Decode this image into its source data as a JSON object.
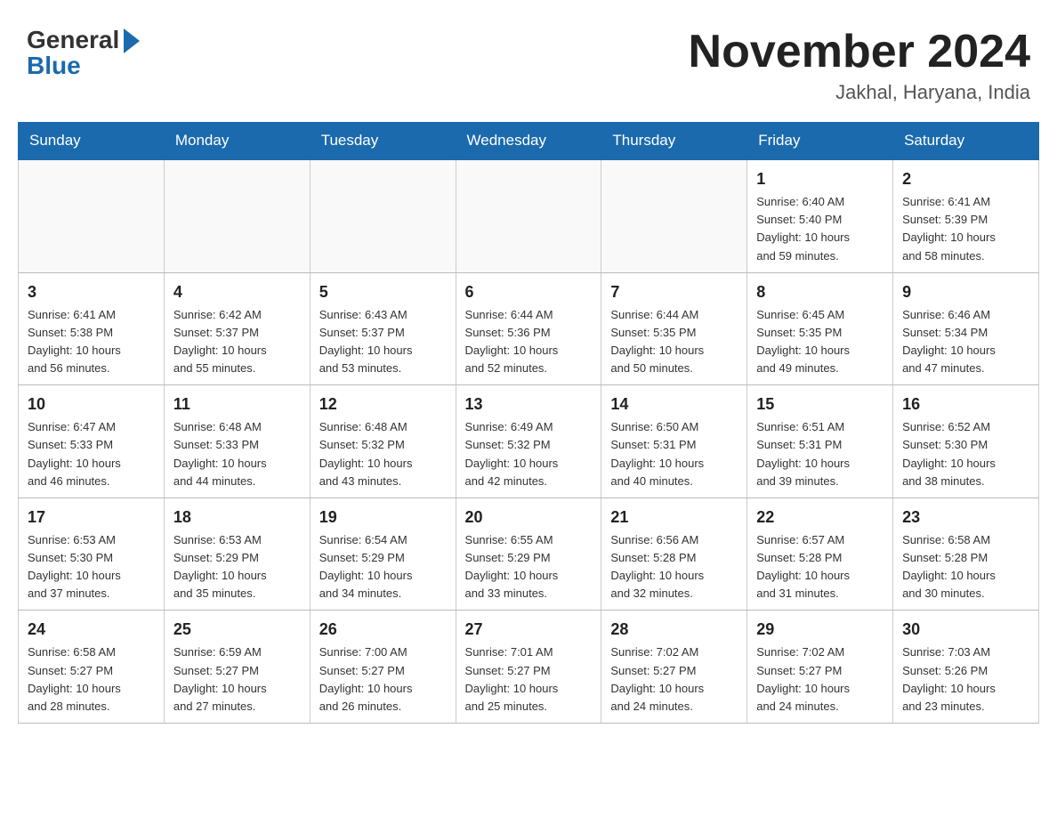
{
  "logo": {
    "general": "General",
    "arrow": "▶",
    "blue": "Blue"
  },
  "title": {
    "month_year": "November 2024",
    "location": "Jakhal, Haryana, India"
  },
  "days_of_week": [
    "Sunday",
    "Monday",
    "Tuesday",
    "Wednesday",
    "Thursday",
    "Friday",
    "Saturday"
  ],
  "weeks": [
    [
      {
        "day": "",
        "info": ""
      },
      {
        "day": "",
        "info": ""
      },
      {
        "day": "",
        "info": ""
      },
      {
        "day": "",
        "info": ""
      },
      {
        "day": "",
        "info": ""
      },
      {
        "day": "1",
        "info": "Sunrise: 6:40 AM\nSunset: 5:40 PM\nDaylight: 10 hours\nand 59 minutes."
      },
      {
        "day": "2",
        "info": "Sunrise: 6:41 AM\nSunset: 5:39 PM\nDaylight: 10 hours\nand 58 minutes."
      }
    ],
    [
      {
        "day": "3",
        "info": "Sunrise: 6:41 AM\nSunset: 5:38 PM\nDaylight: 10 hours\nand 56 minutes."
      },
      {
        "day": "4",
        "info": "Sunrise: 6:42 AM\nSunset: 5:37 PM\nDaylight: 10 hours\nand 55 minutes."
      },
      {
        "day": "5",
        "info": "Sunrise: 6:43 AM\nSunset: 5:37 PM\nDaylight: 10 hours\nand 53 minutes."
      },
      {
        "day": "6",
        "info": "Sunrise: 6:44 AM\nSunset: 5:36 PM\nDaylight: 10 hours\nand 52 minutes."
      },
      {
        "day": "7",
        "info": "Sunrise: 6:44 AM\nSunset: 5:35 PM\nDaylight: 10 hours\nand 50 minutes."
      },
      {
        "day": "8",
        "info": "Sunrise: 6:45 AM\nSunset: 5:35 PM\nDaylight: 10 hours\nand 49 minutes."
      },
      {
        "day": "9",
        "info": "Sunrise: 6:46 AM\nSunset: 5:34 PM\nDaylight: 10 hours\nand 47 minutes."
      }
    ],
    [
      {
        "day": "10",
        "info": "Sunrise: 6:47 AM\nSunset: 5:33 PM\nDaylight: 10 hours\nand 46 minutes."
      },
      {
        "day": "11",
        "info": "Sunrise: 6:48 AM\nSunset: 5:33 PM\nDaylight: 10 hours\nand 44 minutes."
      },
      {
        "day": "12",
        "info": "Sunrise: 6:48 AM\nSunset: 5:32 PM\nDaylight: 10 hours\nand 43 minutes."
      },
      {
        "day": "13",
        "info": "Sunrise: 6:49 AM\nSunset: 5:32 PM\nDaylight: 10 hours\nand 42 minutes."
      },
      {
        "day": "14",
        "info": "Sunrise: 6:50 AM\nSunset: 5:31 PM\nDaylight: 10 hours\nand 40 minutes."
      },
      {
        "day": "15",
        "info": "Sunrise: 6:51 AM\nSunset: 5:31 PM\nDaylight: 10 hours\nand 39 minutes."
      },
      {
        "day": "16",
        "info": "Sunrise: 6:52 AM\nSunset: 5:30 PM\nDaylight: 10 hours\nand 38 minutes."
      }
    ],
    [
      {
        "day": "17",
        "info": "Sunrise: 6:53 AM\nSunset: 5:30 PM\nDaylight: 10 hours\nand 37 minutes."
      },
      {
        "day": "18",
        "info": "Sunrise: 6:53 AM\nSunset: 5:29 PM\nDaylight: 10 hours\nand 35 minutes."
      },
      {
        "day": "19",
        "info": "Sunrise: 6:54 AM\nSunset: 5:29 PM\nDaylight: 10 hours\nand 34 minutes."
      },
      {
        "day": "20",
        "info": "Sunrise: 6:55 AM\nSunset: 5:29 PM\nDaylight: 10 hours\nand 33 minutes."
      },
      {
        "day": "21",
        "info": "Sunrise: 6:56 AM\nSunset: 5:28 PM\nDaylight: 10 hours\nand 32 minutes."
      },
      {
        "day": "22",
        "info": "Sunrise: 6:57 AM\nSunset: 5:28 PM\nDaylight: 10 hours\nand 31 minutes."
      },
      {
        "day": "23",
        "info": "Sunrise: 6:58 AM\nSunset: 5:28 PM\nDaylight: 10 hours\nand 30 minutes."
      }
    ],
    [
      {
        "day": "24",
        "info": "Sunrise: 6:58 AM\nSunset: 5:27 PM\nDaylight: 10 hours\nand 28 minutes."
      },
      {
        "day": "25",
        "info": "Sunrise: 6:59 AM\nSunset: 5:27 PM\nDaylight: 10 hours\nand 27 minutes."
      },
      {
        "day": "26",
        "info": "Sunrise: 7:00 AM\nSunset: 5:27 PM\nDaylight: 10 hours\nand 26 minutes."
      },
      {
        "day": "27",
        "info": "Sunrise: 7:01 AM\nSunset: 5:27 PM\nDaylight: 10 hours\nand 25 minutes."
      },
      {
        "day": "28",
        "info": "Sunrise: 7:02 AM\nSunset: 5:27 PM\nDaylight: 10 hours\nand 24 minutes."
      },
      {
        "day": "29",
        "info": "Sunrise: 7:02 AM\nSunset: 5:27 PM\nDaylight: 10 hours\nand 24 minutes."
      },
      {
        "day": "30",
        "info": "Sunrise: 7:03 AM\nSunset: 5:26 PM\nDaylight: 10 hours\nand 23 minutes."
      }
    ]
  ]
}
